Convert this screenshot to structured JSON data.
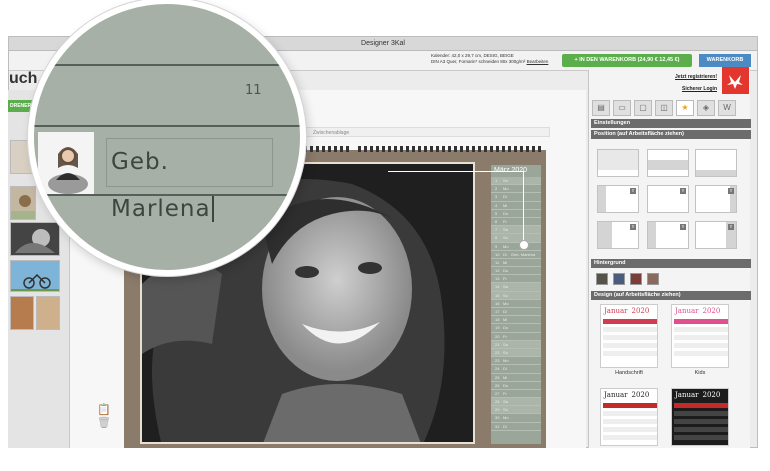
{
  "window": {
    "title": "Designer 3Kal"
  },
  "header": {
    "logo_text": "uch.de",
    "product_info_line1": "Kalender: 42,0 x 29,7 cm, DESIG, BEIGE",
    "product_info_line2": "DIN A3 Quer, Fornarin* schneiden 80x 300g/m²",
    "product_info_link": "Bearbeiten",
    "cart_button": "+ IN DEN WARENKORB (24,90 € 12,45 €)",
    "cart_tab": "WARENKORB"
  },
  "left": {
    "mode_button": "DRENER"
  },
  "workspace": {
    "clipboard_label": "Zwischenablage"
  },
  "calendar": {
    "month_header": "März 2020",
    "rows": [
      {
        "day": "1",
        "abbr": "So",
        "note": ""
      },
      {
        "day": "2",
        "abbr": "Mo",
        "note": ""
      },
      {
        "day": "3",
        "abbr": "Di",
        "note": ""
      },
      {
        "day": "4",
        "abbr": "Mi",
        "note": ""
      },
      {
        "day": "5",
        "abbr": "Do",
        "note": ""
      },
      {
        "day": "6",
        "abbr": "Fr",
        "note": ""
      },
      {
        "day": "7",
        "abbr": "Sa",
        "note": ""
      },
      {
        "day": "8",
        "abbr": "So",
        "note": ""
      },
      {
        "day": "9",
        "abbr": "Mo",
        "note": ""
      },
      {
        "day": "10",
        "abbr": "Di",
        "note": "Geb. Marlena"
      },
      {
        "day": "11",
        "abbr": "Mi",
        "note": ""
      },
      {
        "day": "12",
        "abbr": "Do",
        "note": ""
      },
      {
        "day": "13",
        "abbr": "Fr",
        "note": ""
      },
      {
        "day": "14",
        "abbr": "Sa",
        "note": ""
      },
      {
        "day": "15",
        "abbr": "So",
        "note": ""
      },
      {
        "day": "16",
        "abbr": "Mo",
        "note": ""
      },
      {
        "day": "17",
        "abbr": "Di",
        "note": ""
      },
      {
        "day": "18",
        "abbr": "Mi",
        "note": ""
      },
      {
        "day": "19",
        "abbr": "Do",
        "note": ""
      },
      {
        "day": "20",
        "abbr": "Fr",
        "note": ""
      },
      {
        "day": "21",
        "abbr": "Sa",
        "note": ""
      },
      {
        "day": "22",
        "abbr": "So",
        "note": ""
      },
      {
        "day": "23",
        "abbr": "Mo",
        "note": ""
      },
      {
        "day": "24",
        "abbr": "Di",
        "note": ""
      },
      {
        "day": "25",
        "abbr": "Mi",
        "note": ""
      },
      {
        "day": "26",
        "abbr": "Do",
        "note": ""
      },
      {
        "day": "27",
        "abbr": "Fr",
        "note": ""
      },
      {
        "day": "28",
        "abbr": "Sa",
        "note": ""
      },
      {
        "day": "29",
        "abbr": "So",
        "note": ""
      },
      {
        "day": "30",
        "abbr": "Mo",
        "note": ""
      },
      {
        "day": "31",
        "abbr": "Di",
        "note": ""
      }
    ]
  },
  "zoom": {
    "day_number": "11",
    "birthday_text": "Geb. Marlena"
  },
  "panel": {
    "register_link": "Jetzt registrieren!",
    "login_link": "Sicherer Login",
    "section_settings": "Einstellungen",
    "section_position": "Position (auf Arbeitsfläche ziehen)",
    "section_background": "Hintergrund",
    "section_design": "Design (auf Arbeitsfläche ziehen)",
    "background_swatches": [
      "#55524a",
      "#4a5b7c",
      "#7a3d38",
      "#8a6a5c"
    ],
    "designs": [
      {
        "month": "Januar",
        "year": "2020",
        "name": "Handschrift",
        "accent": "#d13d50",
        "dark": false
      },
      {
        "month": "Januar",
        "year": "2020",
        "name": "Kids",
        "accent": "#e04f8e",
        "dark": false
      },
      {
        "month": "Januar",
        "year": "2020",
        "name": "",
        "accent": "#c42a2a",
        "dark": false
      },
      {
        "month": "Januar",
        "year": "2020",
        "name": "",
        "accent": "#c42a2a",
        "dark": true
      }
    ]
  }
}
